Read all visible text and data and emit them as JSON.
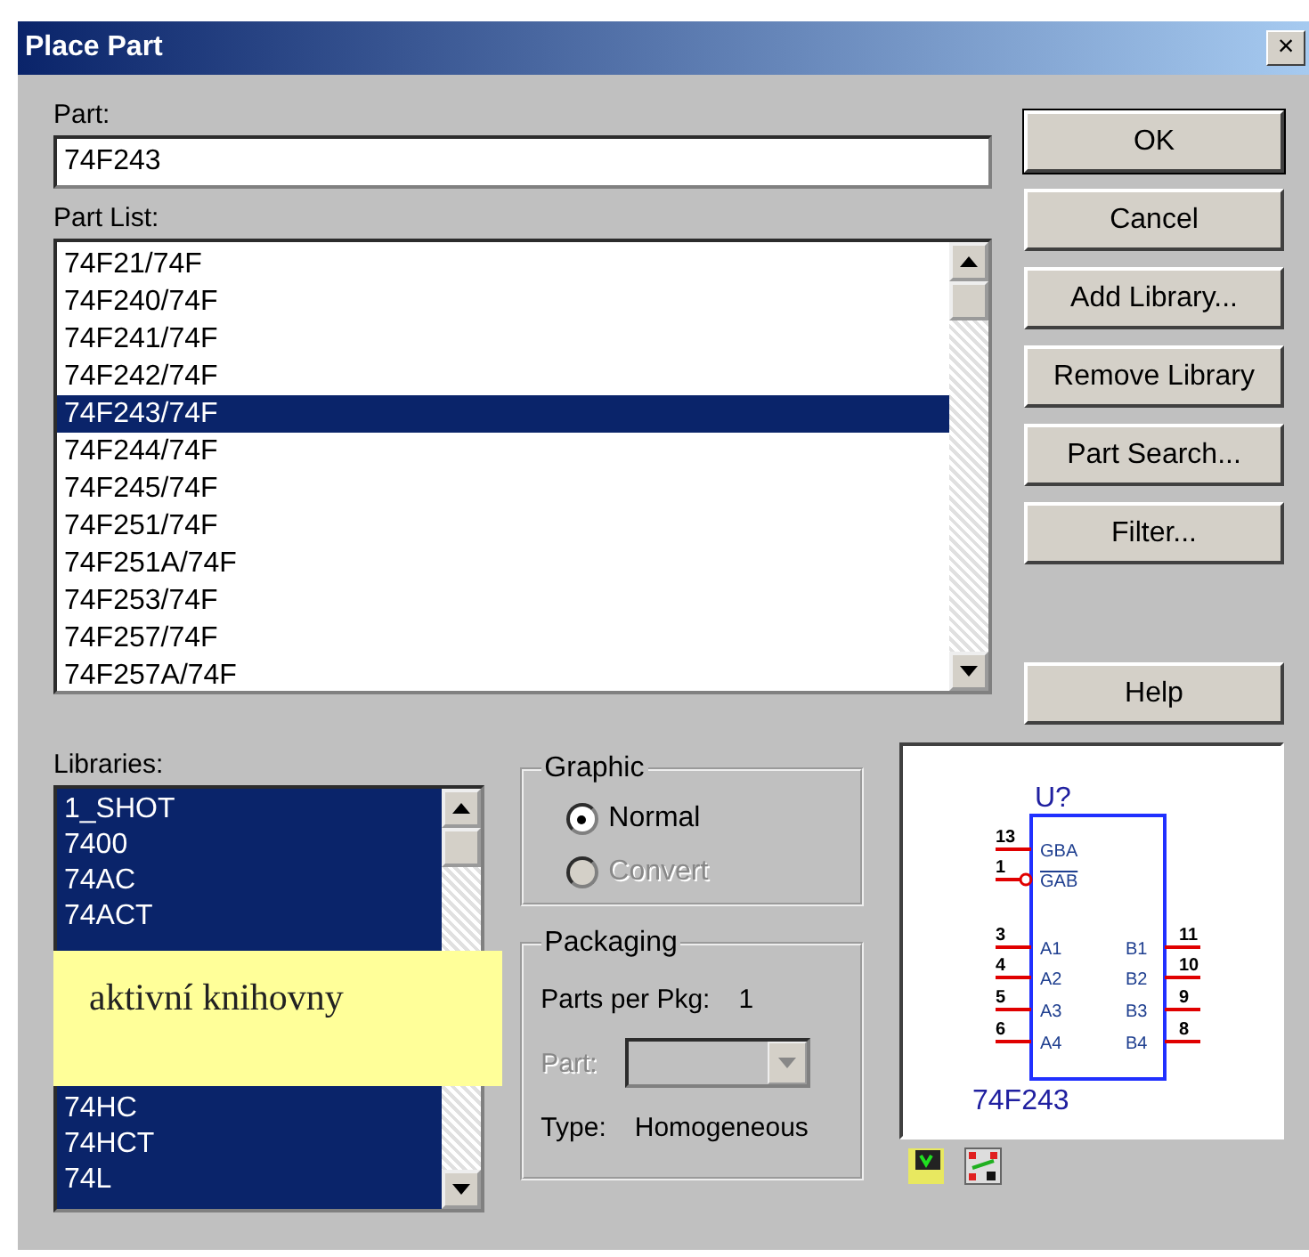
{
  "window": {
    "title": "Place Part",
    "close": "×"
  },
  "part": {
    "label": "Part:",
    "value": "74F243"
  },
  "part_list": {
    "label": "Part List:",
    "items": [
      {
        "text": "74F21/74F",
        "selected": false
      },
      {
        "text": "74F240/74F",
        "selected": false
      },
      {
        "text": "74F241/74F",
        "selected": false
      },
      {
        "text": "74F242/74F",
        "selected": false
      },
      {
        "text": "74F243/74F",
        "selected": true
      },
      {
        "text": "74F244/74F",
        "selected": false
      },
      {
        "text": "74F245/74F",
        "selected": false
      },
      {
        "text": "74F251/74F",
        "selected": false
      },
      {
        "text": "74F251A/74F",
        "selected": false
      },
      {
        "text": "74F253/74F",
        "selected": false
      },
      {
        "text": "74F257/74F",
        "selected": false
      },
      {
        "text": "74F257A/74F",
        "selected": false
      }
    ]
  },
  "buttons": [
    {
      "label": "OK",
      "default": true
    },
    {
      "label": "Cancel",
      "default": false
    },
    {
      "label": "Add Library...",
      "default": false
    },
    {
      "label": "Remove Library",
      "default": false
    },
    {
      "label": "Part Search...",
      "default": false
    },
    {
      "label": "Filter...",
      "default": false
    },
    {
      "label": "Help",
      "default": false
    }
  ],
  "libraries": {
    "label": "Libraries:",
    "items_top": [
      {
        "text": "1_SHOT",
        "selected": true
      },
      {
        "text": "7400",
        "selected": true
      },
      {
        "text": "74AC",
        "selected": true
      },
      {
        "text": "74ACT",
        "selected": true
      }
    ],
    "items_bottom": [
      {
        "text": "74HC",
        "selected": true
      },
      {
        "text": "74HCT",
        "selected": true
      },
      {
        "text": "74L",
        "selected": true
      }
    ]
  },
  "callout": {
    "text": "aktivní knihovny"
  },
  "graphic": {
    "label": "Graphic",
    "options": [
      {
        "label": "Normal",
        "selected": true,
        "disabled": false
      },
      {
        "label": "Convert",
        "selected": false,
        "disabled": true
      }
    ]
  },
  "packaging": {
    "label": "Packaging",
    "parts_label": "Parts per Pkg:",
    "parts_value": "1",
    "part_label": "Part:",
    "part_disabled": true,
    "type_label": "Type:",
    "type_value": "Homogeneous"
  },
  "preview": {
    "ref": "U?",
    "name": "74F243",
    "left_pins": [
      {
        "number": "13",
        "label": "GBA",
        "inverted": false
      },
      {
        "number": "1",
        "label": "GAB",
        "inverted": true
      },
      {
        "number": "3",
        "label": "A1",
        "inverted": false
      },
      {
        "number": "4",
        "label": "A2",
        "inverted": false
      },
      {
        "number": "5",
        "label": "A3",
        "inverted": false
      },
      {
        "number": "6",
        "label": "A4",
        "inverted": false
      }
    ],
    "right_pins": [
      {
        "number": "11",
        "label": "B1"
      },
      {
        "number": "10",
        "label": "B2"
      },
      {
        "number": "9",
        "label": "B3"
      },
      {
        "number": "8",
        "label": "B4"
      }
    ]
  }
}
